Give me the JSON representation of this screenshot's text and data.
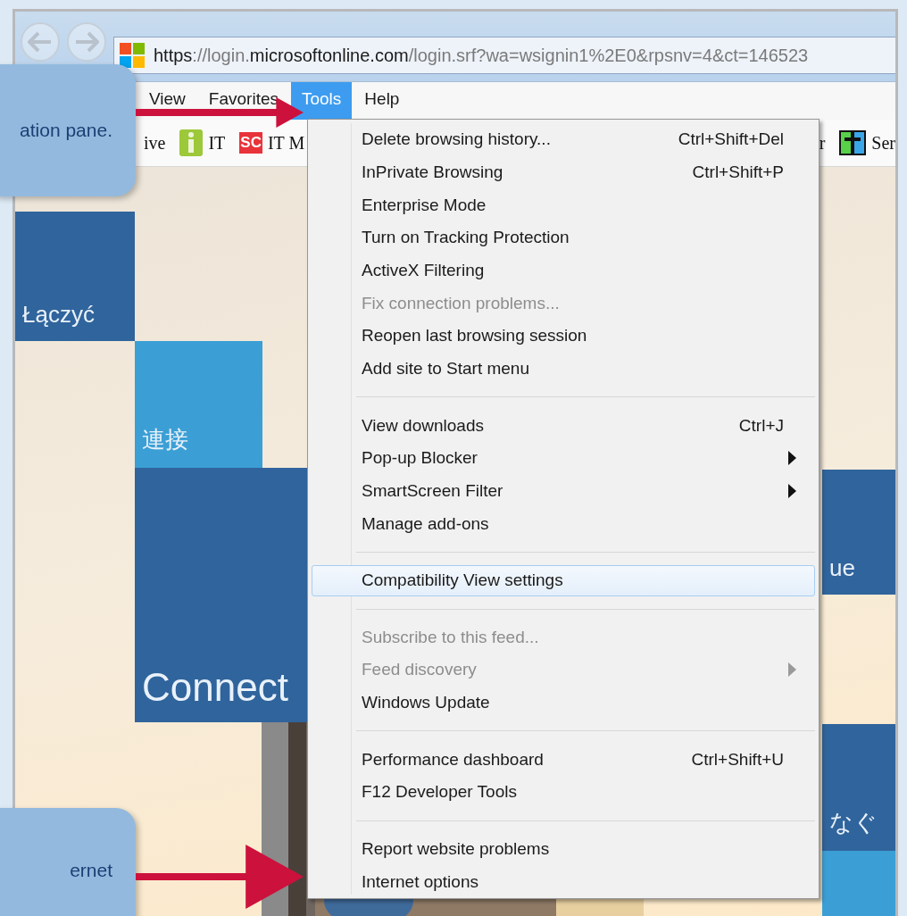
{
  "address_bar": {
    "url": "**https**://login.**microsoftonline.com**/login.srf?wa=wsignin1%2E0&rpsnv=4&ct=146523"
  },
  "menu_bar": [
    {
      "label": "View",
      "selected": false
    },
    {
      "label": "Favorites",
      "selected": false
    },
    {
      "label": "Tools",
      "selected": true
    },
    {
      "label": "Help",
      "selected": false
    }
  ],
  "favorites_bar": {
    "left": [
      {
        "label": "ive",
        "kind": "text"
      },
      {
        "label": "IT",
        "kind": "info"
      },
      {
        "label": "IT M",
        "kind": "badge",
        "badge": "SC"
      }
    ],
    "right": [
      {
        "label": "r",
        "kind": "text"
      },
      {
        "label": "Ser",
        "kind": "grid"
      }
    ]
  },
  "page_tiles": [
    {
      "label": "Łączyć",
      "kind": "dark"
    },
    {
      "label": "連接",
      "kind": "light"
    },
    {
      "label": "Connect",
      "kind": "dark"
    },
    {
      "label": "ue",
      "kind": "dark"
    },
    {
      "label": "なぐ",
      "kind": "dark"
    },
    {
      "kind": "light"
    }
  ],
  "tools_menu": {
    "groups": [
      {
        "items": [
          {
            "label": "Delete browsing history...",
            "shortcut": "Ctrl+Shift+Del",
            "kind": "command",
            "disabled": false,
            "selected": false
          },
          {
            "label": "InPrivate Browsing",
            "shortcut": "Ctrl+Shift+P",
            "kind": "command",
            "disabled": false,
            "selected": false
          },
          {
            "label": "Enterprise Mode",
            "kind": "command",
            "disabled": false,
            "selected": false
          },
          {
            "label": "Turn on Tracking Protection",
            "kind": "command",
            "disabled": false,
            "selected": false
          },
          {
            "label": "ActiveX Filtering",
            "kind": "command",
            "disabled": false,
            "selected": false
          },
          {
            "label": "Fix connection problems...",
            "kind": "command",
            "disabled": true,
            "selected": false
          },
          {
            "label": "Reopen last browsing session",
            "kind": "command",
            "disabled": false,
            "selected": false
          },
          {
            "label": "Add site to Start menu",
            "kind": "command",
            "disabled": false,
            "selected": false
          }
        ]
      },
      {
        "items": [
          {
            "label": "View downloads",
            "shortcut": "Ctrl+J",
            "kind": "command",
            "disabled": false,
            "selected": false
          },
          {
            "label": "Pop-up Blocker",
            "kind": "submenu",
            "disabled": false,
            "selected": false
          },
          {
            "label": "SmartScreen Filter",
            "kind": "submenu",
            "disabled": false,
            "selected": false
          },
          {
            "label": "Manage add-ons",
            "kind": "command",
            "disabled": false,
            "selected": false
          }
        ]
      },
      {
        "items": [
          {
            "label": "Compatibility View settings",
            "kind": "command",
            "disabled": false,
            "selected": true
          }
        ]
      },
      {
        "items": [
          {
            "label": "Subscribe to this feed...",
            "kind": "command",
            "disabled": true,
            "selected": false
          },
          {
            "label": "Feed discovery",
            "kind": "submenu",
            "disabled": true,
            "selected": false
          },
          {
            "label": "Windows Update",
            "kind": "command",
            "disabled": false,
            "selected": false
          }
        ]
      },
      {
        "items": [
          {
            "label": "Performance dashboard",
            "shortcut": "Ctrl+Shift+U",
            "kind": "command",
            "disabled": false,
            "selected": false
          },
          {
            "label": "F12 Developer Tools",
            "kind": "command",
            "disabled": false,
            "selected": false
          }
        ]
      },
      {
        "items": [
          {
            "label": "Report website problems",
            "kind": "command",
            "disabled": false,
            "selected": false
          },
          {
            "label": "Internet options",
            "kind": "command",
            "disabled": false,
            "selected": false
          }
        ]
      }
    ]
  },
  "callouts": [
    {
      "text": "ation pane."
    },
    {
      "text": "ernet"
    }
  ]
}
